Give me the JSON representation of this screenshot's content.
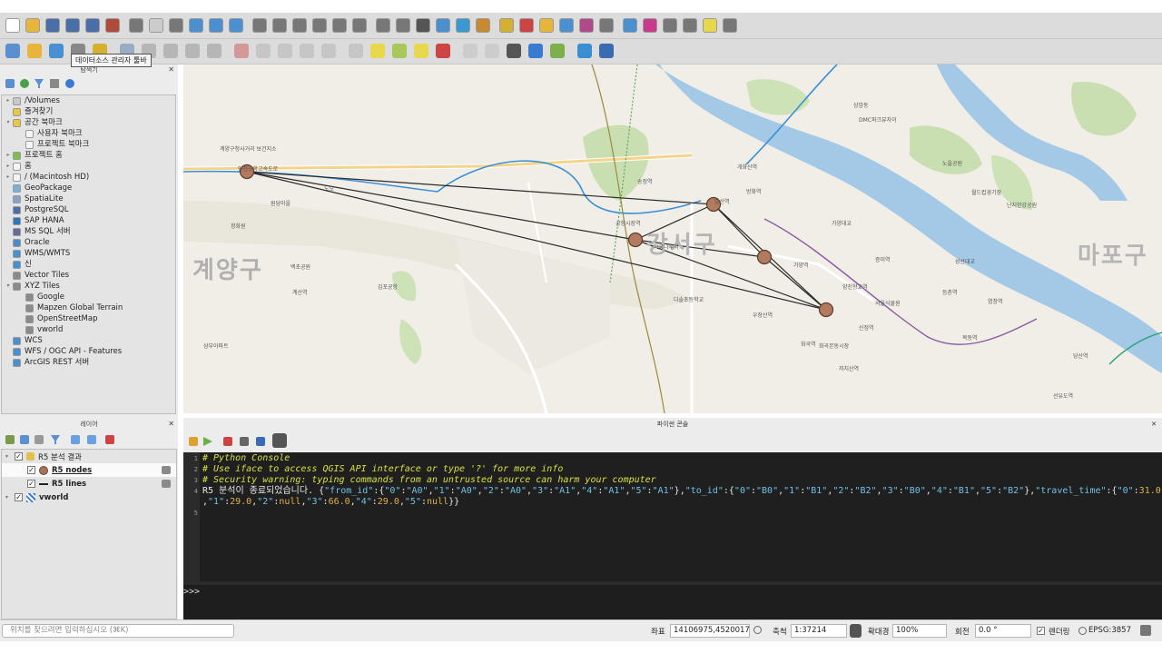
{
  "tooltip": "데이터소스 관리자 툴바",
  "browser": {
    "title": "탐색기",
    "items": [
      {
        "label": "/Volumes",
        "arrow": "▸",
        "color": "#c9c9c9",
        "indent": 0
      },
      {
        "label": "즐겨찾기",
        "arrow": "",
        "color": "#e8c840",
        "indent": 0
      },
      {
        "label": "공간 북마크",
        "arrow": "▾",
        "color": "#e8c840",
        "indent": 0
      },
      {
        "label": "사용자 북마크",
        "arrow": "",
        "color": "#f4f4f4",
        "indent": 1
      },
      {
        "label": "프로젝트 북마크",
        "arrow": "",
        "color": "#f4f4f4",
        "indent": 1
      },
      {
        "label": "프로젝트 홈",
        "arrow": "▸",
        "color": "#7cbf4a",
        "indent": 0
      },
      {
        "label": "홈",
        "arrow": "▸",
        "color": "#f4f4f4",
        "indent": 0
      },
      {
        "label": "/ (Macintosh HD)",
        "arrow": "▸",
        "color": "#f4f4f4",
        "indent": 0
      },
      {
        "label": "GeoPackage",
        "arrow": "",
        "color": "#7cb0d8",
        "indent": 0
      },
      {
        "label": "SpatiaLite",
        "arrow": "",
        "color": "#8aa0c8",
        "indent": 0
      },
      {
        "label": "PostgreSQL",
        "arrow": "",
        "color": "#4e6ea8",
        "indent": 0
      },
      {
        "label": "SAP HANA",
        "arrow": "",
        "color": "#2f75c0",
        "indent": 0
      },
      {
        "label": "MS SQL 서버",
        "arrow": "",
        "color": "#6a6a9a",
        "indent": 0
      },
      {
        "label": "Oracle",
        "arrow": "",
        "color": "#4e8ac8",
        "indent": 0
      },
      {
        "label": "WMS/WMTS",
        "arrow": "",
        "color": "#4a8fd0",
        "indent": 0
      },
      {
        "label": "신",
        "arrow": "",
        "color": "#4a8fd0",
        "indent": 0
      },
      {
        "label": "Vector Tiles",
        "arrow": "",
        "color": "#8a8a8a",
        "indent": 0
      },
      {
        "label": "XYZ Tiles",
        "arrow": "▾",
        "color": "#8a8a8a",
        "indent": 0
      },
      {
        "label": "Google",
        "arrow": "",
        "color": "#8a8a8a",
        "indent": 1
      },
      {
        "label": "Mapzen Global Terrain",
        "arrow": "",
        "color": "#8a8a8a",
        "indent": 1
      },
      {
        "label": "OpenStreetMap",
        "arrow": "",
        "color": "#8a8a8a",
        "indent": 1
      },
      {
        "label": "vworld",
        "arrow": "",
        "color": "#8a8a8a",
        "indent": 1
      },
      {
        "label": "WCS",
        "arrow": "",
        "color": "#4a8fd0",
        "indent": 0
      },
      {
        "label": "WFS / OGC API - Features",
        "arrow": "",
        "color": "#4a8fd0",
        "indent": 0
      },
      {
        "label": "ArcGIS REST 서버",
        "arrow": "",
        "color": "#4a8fd0",
        "indent": 0
      }
    ]
  },
  "layers": {
    "title": "레이어",
    "group": "R5 분석 결과",
    "nodes": "R5 nodes",
    "lines": "R5 lines",
    "basemap": "vworld"
  },
  "map": {
    "district_left": "계양구",
    "district_mid": "강서구",
    "district_right": "마포구",
    "labels": [
      {
        "t": "계양구청사거리 보건지소"
      },
      {
        "t": "정화원"
      },
      {
        "t": "백초공원"
      },
      {
        "t": "계산역"
      },
      {
        "t": "삼부아파트"
      },
      {
        "t": "인천공항고속도로"
      },
      {
        "t": "노오"
      },
      {
        "t": "원당마을"
      },
      {
        "t": "김포공항"
      },
      {
        "t": "공항시장역"
      },
      {
        "t": "송정역"
      },
      {
        "t": "발산역"
      },
      {
        "t": "우장산역"
      },
      {
        "t": "화곡역"
      },
      {
        "t": "까치산역"
      },
      {
        "t": "신정역"
      },
      {
        "t": "증미역"
      },
      {
        "t": "가양역"
      },
      {
        "t": "양천향교역"
      },
      {
        "t": "마곡나루역"
      },
      {
        "t": "개화산역"
      },
      {
        "t": "방화역"
      },
      {
        "t": "가양대교"
      },
      {
        "t": "월드컵경기장"
      },
      {
        "t": "난지한강공원"
      },
      {
        "t": "노을공원"
      },
      {
        "t": "상암동"
      },
      {
        "t": "DMC파크뷰자이"
      },
      {
        "t": "성산대교"
      },
      {
        "t": "목동역"
      },
      {
        "t": "등촌역"
      },
      {
        "t": "염창역"
      },
      {
        "t": "선유도역"
      },
      {
        "t": "당산역"
      },
      {
        "t": "서울식물원"
      },
      {
        "t": "다솔초등학교"
      },
      {
        "t": "화곡본동시장"
      },
      {
        "t": "방신시장"
      }
    ]
  },
  "console": {
    "title": "파이썬 콘솔",
    "lines": [
      "# Python Console",
      "# Use iface to access QGIS API interface or type '?' for more info",
      "# Security warning: typing commands from an untrusted source can harm your computer",
      "R5 분석이 종료되었습니다. {\"from_id\":{\"0\":\"A0\",\"1\":\"A0\",\"2\":\"A0\",\"3\":\"A1\",\"4\":\"A1\",\"5\":\"A1\"},\"to_id\":{\"0\":\"B0\",\"1\":\"B1\",\"2\":\"B2\",\"3\":\"B0\",\"4\":\"B1\",\"5\":\"B2\"},\"travel_time\":{\"0\":31.0",
      ",\"1\":29.0,\"2\":null,\"3\":66.0,\"4\":29.0,\"5\":null}}",
      ""
    ],
    "line_numbers": [
      "1",
      "2",
      "3",
      "4",
      "",
      "5"
    ],
    "prompt": ">>>"
  },
  "status": {
    "locator_placeholder": "위치를 찾으려면 입력하십시오 (⌘K)",
    "coord_label": "좌표",
    "coord": "14106975,4520017",
    "scale_label": "축척",
    "scale": "1:37214",
    "magnifier_label": "확대경",
    "magnifier": "100%",
    "rotation_label": "회전",
    "rotation": "0.0 °",
    "render_label": "렌더링",
    "crs": "EPSG:3857"
  }
}
